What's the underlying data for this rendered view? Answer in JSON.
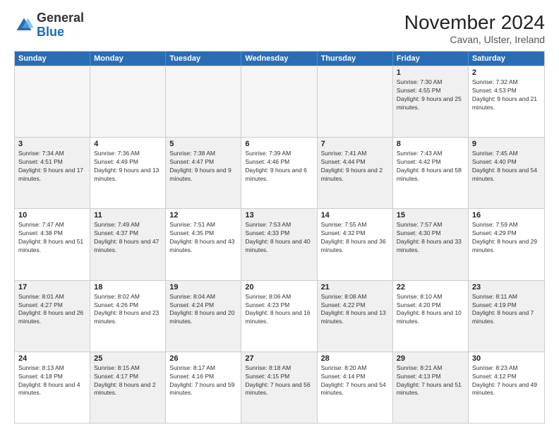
{
  "logo": {
    "general": "General",
    "blue": "Blue"
  },
  "header": {
    "title": "November 2024",
    "subtitle": "Cavan, Ulster, Ireland"
  },
  "calendar": {
    "days_of_week": [
      "Sunday",
      "Monday",
      "Tuesday",
      "Wednesday",
      "Thursday",
      "Friday",
      "Saturday"
    ],
    "rows": [
      [
        {
          "day": "",
          "empty": true
        },
        {
          "day": "",
          "empty": true
        },
        {
          "day": "",
          "empty": true
        },
        {
          "day": "",
          "empty": true
        },
        {
          "day": "",
          "empty": true
        },
        {
          "day": "1",
          "sunrise": "Sunrise: 7:30 AM",
          "sunset": "Sunset: 4:55 PM",
          "daylight": "Daylight: 9 hours and 25 minutes.",
          "shaded": true
        },
        {
          "day": "2",
          "sunrise": "Sunrise: 7:32 AM",
          "sunset": "Sunset: 4:53 PM",
          "daylight": "Daylight: 9 hours and 21 minutes.",
          "shaded": false
        }
      ],
      [
        {
          "day": "3",
          "sunrise": "Sunrise: 7:34 AM",
          "sunset": "Sunset: 4:51 PM",
          "daylight": "Daylight: 9 hours and 17 minutes.",
          "shaded": true
        },
        {
          "day": "4",
          "sunrise": "Sunrise: 7:36 AM",
          "sunset": "Sunset: 4:49 PM",
          "daylight": "Daylight: 9 hours and 13 minutes.",
          "shaded": false
        },
        {
          "day": "5",
          "sunrise": "Sunrise: 7:38 AM",
          "sunset": "Sunset: 4:47 PM",
          "daylight": "Daylight: 9 hours and 9 minutes.",
          "shaded": true
        },
        {
          "day": "6",
          "sunrise": "Sunrise: 7:39 AM",
          "sunset": "Sunset: 4:46 PM",
          "daylight": "Daylight: 9 hours and 6 minutes.",
          "shaded": false
        },
        {
          "day": "7",
          "sunrise": "Sunrise: 7:41 AM",
          "sunset": "Sunset: 4:44 PM",
          "daylight": "Daylight: 9 hours and 2 minutes.",
          "shaded": true
        },
        {
          "day": "8",
          "sunrise": "Sunrise: 7:43 AM",
          "sunset": "Sunset: 4:42 PM",
          "daylight": "Daylight: 8 hours and 58 minutes.",
          "shaded": false
        },
        {
          "day": "9",
          "sunrise": "Sunrise: 7:45 AM",
          "sunset": "Sunset: 4:40 PM",
          "daylight": "Daylight: 8 hours and 54 minutes.",
          "shaded": true
        }
      ],
      [
        {
          "day": "10",
          "sunrise": "Sunrise: 7:47 AM",
          "sunset": "Sunset: 4:38 PM",
          "daylight": "Daylight: 8 hours and 51 minutes.",
          "shaded": false
        },
        {
          "day": "11",
          "sunrise": "Sunrise: 7:49 AM",
          "sunset": "Sunset: 4:37 PM",
          "daylight": "Daylight: 8 hours and 47 minutes.",
          "shaded": true
        },
        {
          "day": "12",
          "sunrise": "Sunrise: 7:51 AM",
          "sunset": "Sunset: 4:35 PM",
          "daylight": "Daylight: 8 hours and 43 minutes.",
          "shaded": false
        },
        {
          "day": "13",
          "sunrise": "Sunrise: 7:53 AM",
          "sunset": "Sunset: 4:33 PM",
          "daylight": "Daylight: 8 hours and 40 minutes.",
          "shaded": true
        },
        {
          "day": "14",
          "sunrise": "Sunrise: 7:55 AM",
          "sunset": "Sunset: 4:32 PM",
          "daylight": "Daylight: 8 hours and 36 minutes.",
          "shaded": false
        },
        {
          "day": "15",
          "sunrise": "Sunrise: 7:57 AM",
          "sunset": "Sunset: 4:30 PM",
          "daylight": "Daylight: 8 hours and 33 minutes.",
          "shaded": true
        },
        {
          "day": "16",
          "sunrise": "Sunrise: 7:59 AM",
          "sunset": "Sunset: 4:29 PM",
          "daylight": "Daylight: 8 hours and 29 minutes.",
          "shaded": false
        }
      ],
      [
        {
          "day": "17",
          "sunrise": "Sunrise: 8:01 AM",
          "sunset": "Sunset: 4:27 PM",
          "daylight": "Daylight: 8 hours and 26 minutes.",
          "shaded": true
        },
        {
          "day": "18",
          "sunrise": "Sunrise: 8:02 AM",
          "sunset": "Sunset: 4:26 PM",
          "daylight": "Daylight: 8 hours and 23 minutes.",
          "shaded": false
        },
        {
          "day": "19",
          "sunrise": "Sunrise: 8:04 AM",
          "sunset": "Sunset: 4:24 PM",
          "daylight": "Daylight: 8 hours and 20 minutes.",
          "shaded": true
        },
        {
          "day": "20",
          "sunrise": "Sunrise: 8:06 AM",
          "sunset": "Sunset: 4:23 PM",
          "daylight": "Daylight: 8 hours and 16 minutes.",
          "shaded": false
        },
        {
          "day": "21",
          "sunrise": "Sunrise: 8:08 AM",
          "sunset": "Sunset: 4:22 PM",
          "daylight": "Daylight: 8 hours and 13 minutes.",
          "shaded": true
        },
        {
          "day": "22",
          "sunrise": "Sunrise: 8:10 AM",
          "sunset": "Sunset: 4:20 PM",
          "daylight": "Daylight: 8 hours and 10 minutes.",
          "shaded": false
        },
        {
          "day": "23",
          "sunrise": "Sunrise: 8:11 AM",
          "sunset": "Sunset: 4:19 PM",
          "daylight": "Daylight: 8 hours and 7 minutes.",
          "shaded": true
        }
      ],
      [
        {
          "day": "24",
          "sunrise": "Sunrise: 8:13 AM",
          "sunset": "Sunset: 4:18 PM",
          "daylight": "Daylight: 8 hours and 4 minutes.",
          "shaded": false
        },
        {
          "day": "25",
          "sunrise": "Sunrise: 8:15 AM",
          "sunset": "Sunset: 4:17 PM",
          "daylight": "Daylight: 8 hours and 2 minutes.",
          "shaded": true
        },
        {
          "day": "26",
          "sunrise": "Sunrise: 8:17 AM",
          "sunset": "Sunset: 4:16 PM",
          "daylight": "Daylight: 7 hours and 59 minutes.",
          "shaded": false
        },
        {
          "day": "27",
          "sunrise": "Sunrise: 8:18 AM",
          "sunset": "Sunset: 4:15 PM",
          "daylight": "Daylight: 7 hours and 56 minutes.",
          "shaded": true
        },
        {
          "day": "28",
          "sunrise": "Sunrise: 8:20 AM",
          "sunset": "Sunset: 4:14 PM",
          "daylight": "Daylight: 7 hours and 54 minutes.",
          "shaded": false
        },
        {
          "day": "29",
          "sunrise": "Sunrise: 8:21 AM",
          "sunset": "Sunset: 4:13 PM",
          "daylight": "Daylight: 7 hours and 51 minutes.",
          "shaded": true
        },
        {
          "day": "30",
          "sunrise": "Sunrise: 8:23 AM",
          "sunset": "Sunset: 4:12 PM",
          "daylight": "Daylight: 7 hours and 49 minutes.",
          "shaded": false
        }
      ]
    ]
  }
}
